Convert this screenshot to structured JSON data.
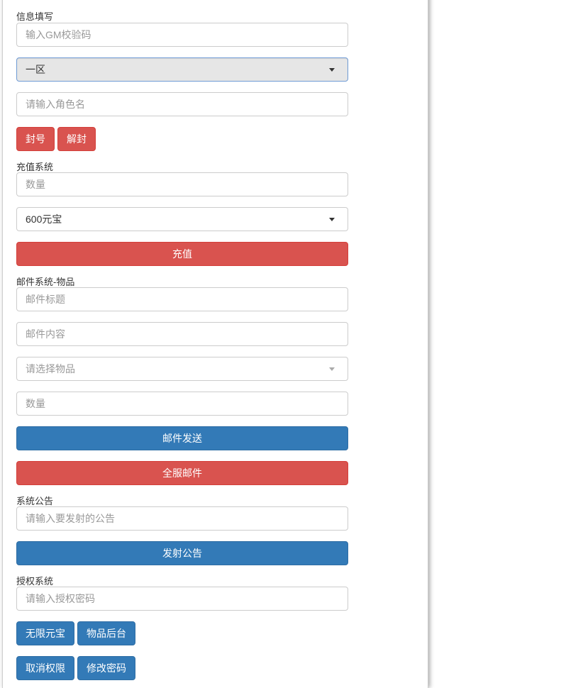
{
  "info": {
    "section_label": "信息填写",
    "gm_code_placeholder": "输入GM校验码",
    "server_select_value": "一区",
    "role_name_placeholder": "请输入角色名",
    "ban_button": "封号",
    "unban_button": "解封"
  },
  "recharge": {
    "section_label": "充值系统",
    "amount_placeholder": "数量",
    "package_select_value": "600元宝",
    "recharge_button": "充值"
  },
  "mail": {
    "section_label": "邮件系统-物品",
    "title_placeholder": "邮件标题",
    "content_placeholder": "邮件内容",
    "item_select_placeholder": "请选择物品",
    "quantity_placeholder": "数量",
    "send_button": "邮件发送",
    "server_wide_button": "全服邮件"
  },
  "announcement": {
    "section_label": "系统公告",
    "input_placeholder": "请输入要发射的公告",
    "publish_button": "发射公告"
  },
  "auth": {
    "section_label": "授权系统",
    "password_placeholder": "请输入授权密码",
    "unlimited_yuanbao_button": "无限元宝",
    "item_backend_button": "物品后台",
    "revoke_button": "取消权限",
    "change_password_button": "修改密码"
  },
  "colors": {
    "danger": "#d9534f",
    "primary": "#337ab7"
  }
}
